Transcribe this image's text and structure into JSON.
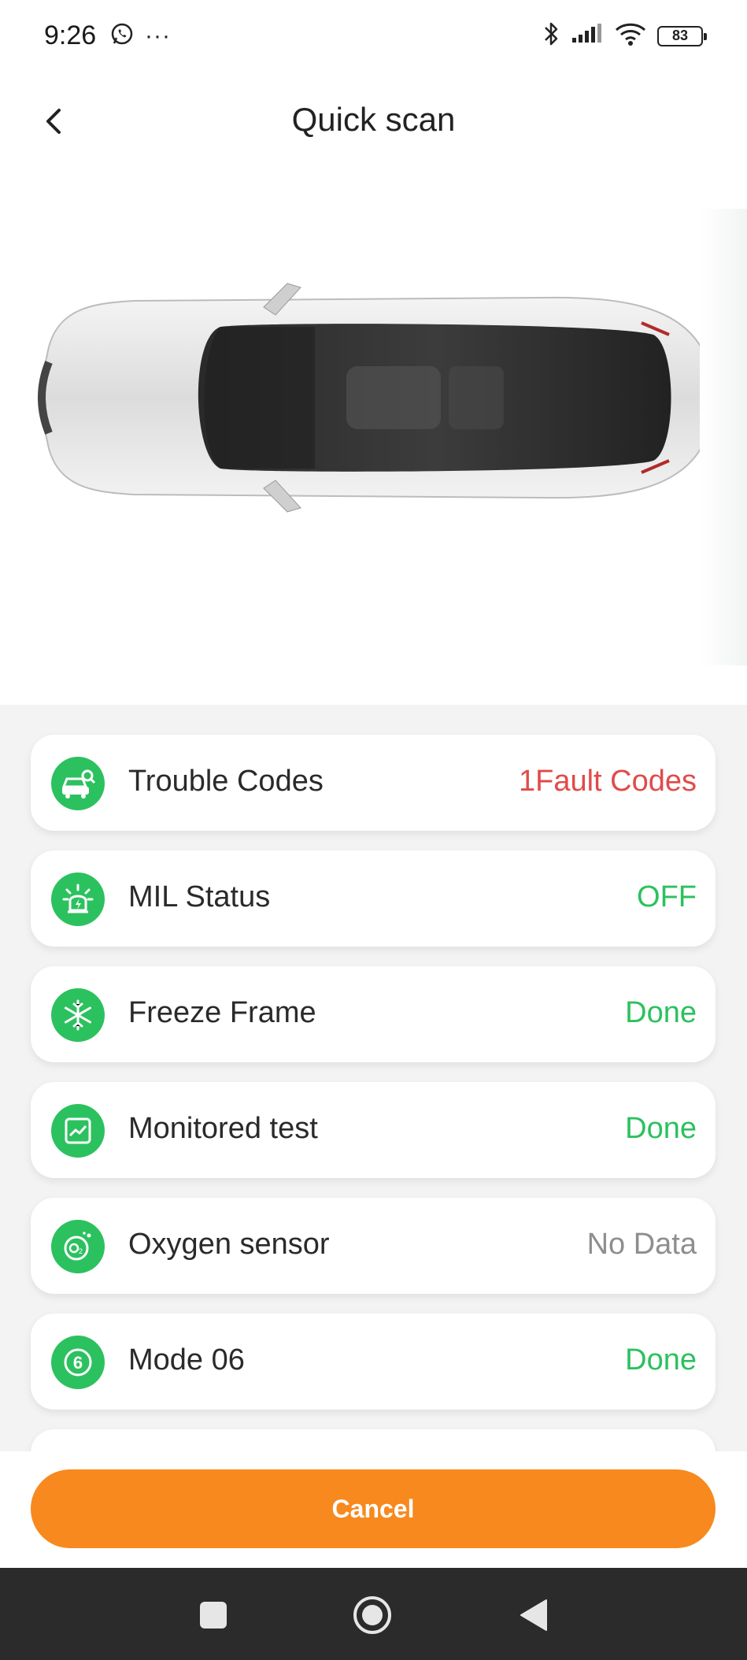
{
  "status_bar": {
    "time": "9:26",
    "left_icons": [
      "whatsapp-icon"
    ],
    "dots": "···",
    "right_icons": [
      "bluetooth-icon",
      "signal-icon",
      "wifi-icon"
    ],
    "battery": "83"
  },
  "header": {
    "title": "Quick scan",
    "back_icon": "chevron-left-icon"
  },
  "colors": {
    "accent_green": "#2cc15f",
    "fault_red": "#e24a4a",
    "no_data_gray": "#8e8e8e",
    "cancel_orange": "#f7891e"
  },
  "items": [
    {
      "label": "Trouble Codes",
      "value": "1Fault Codes",
      "icon": "car-search-icon",
      "status": "fault"
    },
    {
      "label": "MIL Status",
      "value": "OFF",
      "icon": "warning-light-icon",
      "status": "ok"
    },
    {
      "label": "Freeze Frame",
      "value": "Done",
      "icon": "snowflake-icon",
      "status": "ok"
    },
    {
      "label": "Monitored test",
      "value": "Done",
      "icon": "line-chart-icon",
      "status": "ok"
    },
    {
      "label": "Oxygen sensor",
      "value": "No Data",
      "icon": "o2-sensor-icon",
      "status": "nodata"
    },
    {
      "label": "Mode 06",
      "value": "Done",
      "icon": "number-six-icon",
      "status": "ok"
    }
  ],
  "actions": {
    "cancel_label": "Cancel"
  },
  "nav_bar": {
    "buttons": [
      "recent-apps-icon",
      "home-icon",
      "back-triangle-icon"
    ]
  }
}
